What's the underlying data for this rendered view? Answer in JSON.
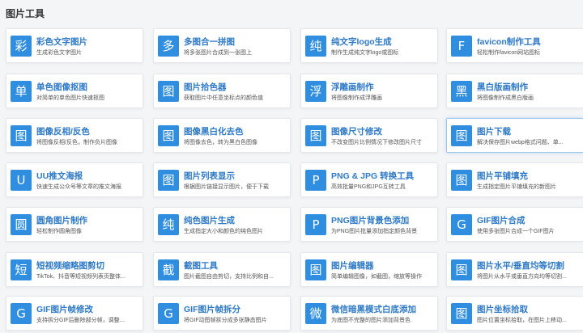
{
  "section": {
    "title": "图片工具"
  },
  "tools": [
    {
      "icon": "彩",
      "title": "彩色文字图片",
      "desc": "生成彩色文字图片"
    },
    {
      "icon": "多",
      "title": "多图合一拼图",
      "desc": "将多张图片合成到一张图上"
    },
    {
      "icon": "纯",
      "title": "纯文字logo生成",
      "desc": "制作生成纯文字logo或图标"
    },
    {
      "icon": "F",
      "title": "favicon制作工具",
      "desc": "轻松制作favicon网站图标"
    },
    {
      "icon": "单",
      "title": "单色图像抠图",
      "desc": "对简单的单色图片快速抠图"
    },
    {
      "icon": "图",
      "title": "图片拾色器",
      "desc": "获取图片中任意坐标点的颜色值"
    },
    {
      "icon": "浮",
      "title": "浮雕画制作",
      "desc": "将图像制作成浮雕画"
    },
    {
      "icon": "黑",
      "title": "黑白版画制作",
      "desc": "将图像制作成黑白版画"
    },
    {
      "icon": "图",
      "title": "图像反相/反色",
      "desc": "将图像反相/反色，制作负片图像"
    },
    {
      "icon": "图",
      "title": "图像黑白化去色",
      "desc": "将图像去色，转为黑白色图像"
    },
    {
      "icon": "图",
      "title": "图像尺寸修改",
      "desc": "不改变图片比例情况下修改图片尺寸"
    },
    {
      "icon": "图",
      "title": "图片下载",
      "desc": "解决保存图片webp格式问题、单..."
    },
    {
      "icon": "U",
      "title": "UU推文海报",
      "desc": "快速生成公众号等文章的推文海报"
    },
    {
      "icon": "图",
      "title": "图片列表显示",
      "desc": "根据图片链接显示图片，便于下载"
    },
    {
      "icon": "P",
      "title": "PNG & JPG 转换工具",
      "desc": "高效批量PNG和JPG互转工具"
    },
    {
      "icon": "图",
      "title": "图片平铺填充",
      "desc": "生成指定图片平铺填充的新图片"
    },
    {
      "icon": "圆",
      "title": "圆角图片制作",
      "desc": "轻松制作圆角图像"
    },
    {
      "icon": "纯",
      "title": "纯色图片生成",
      "desc": "生成指定大小和颜色的纯色图片"
    },
    {
      "icon": "P",
      "title": "PNG图片背景色添加",
      "desc": "为PNG图片批量添加指定颜色背景"
    },
    {
      "icon": "G",
      "title": "GIF图片合成",
      "desc": "使用多张图片合成一个GIF图片"
    },
    {
      "icon": "短",
      "title": "短视频缩略图剪切",
      "desc": "TikTok、抖音等短视频列表页整体..."
    },
    {
      "icon": "截",
      "title": "截图工具",
      "desc": "图片截图自由剪切，支持比例和自..."
    },
    {
      "icon": "图",
      "title": "图片编辑器",
      "desc": "简单编辑图像，如截图，缩放等操作"
    },
    {
      "icon": "图",
      "title": "图片水平/垂直均等切割",
      "desc": "将图片从水平或垂直方向均等切割..."
    },
    {
      "icon": "G",
      "title": "GIF图片帧修改",
      "desc": "支持拆分GIF后删除部分帧，调整..."
    },
    {
      "icon": "G",
      "title": "GIF图片帧拆分",
      "desc": "将GIF动图帧拆分成多张静态图片"
    },
    {
      "icon": "微",
      "title": "微信暗黑模式白底添加",
      "desc": "为底图不完整的图片添加背景色"
    },
    {
      "icon": "图",
      "title": "图片坐标拾取",
      "desc": "图片位置坐标拾取，在图片上移动..."
    }
  ],
  "highlighted_index": 11,
  "colors": {
    "accent": "#2f8ee0",
    "title": "#2e79c6",
    "background": "#f3f5f7"
  }
}
